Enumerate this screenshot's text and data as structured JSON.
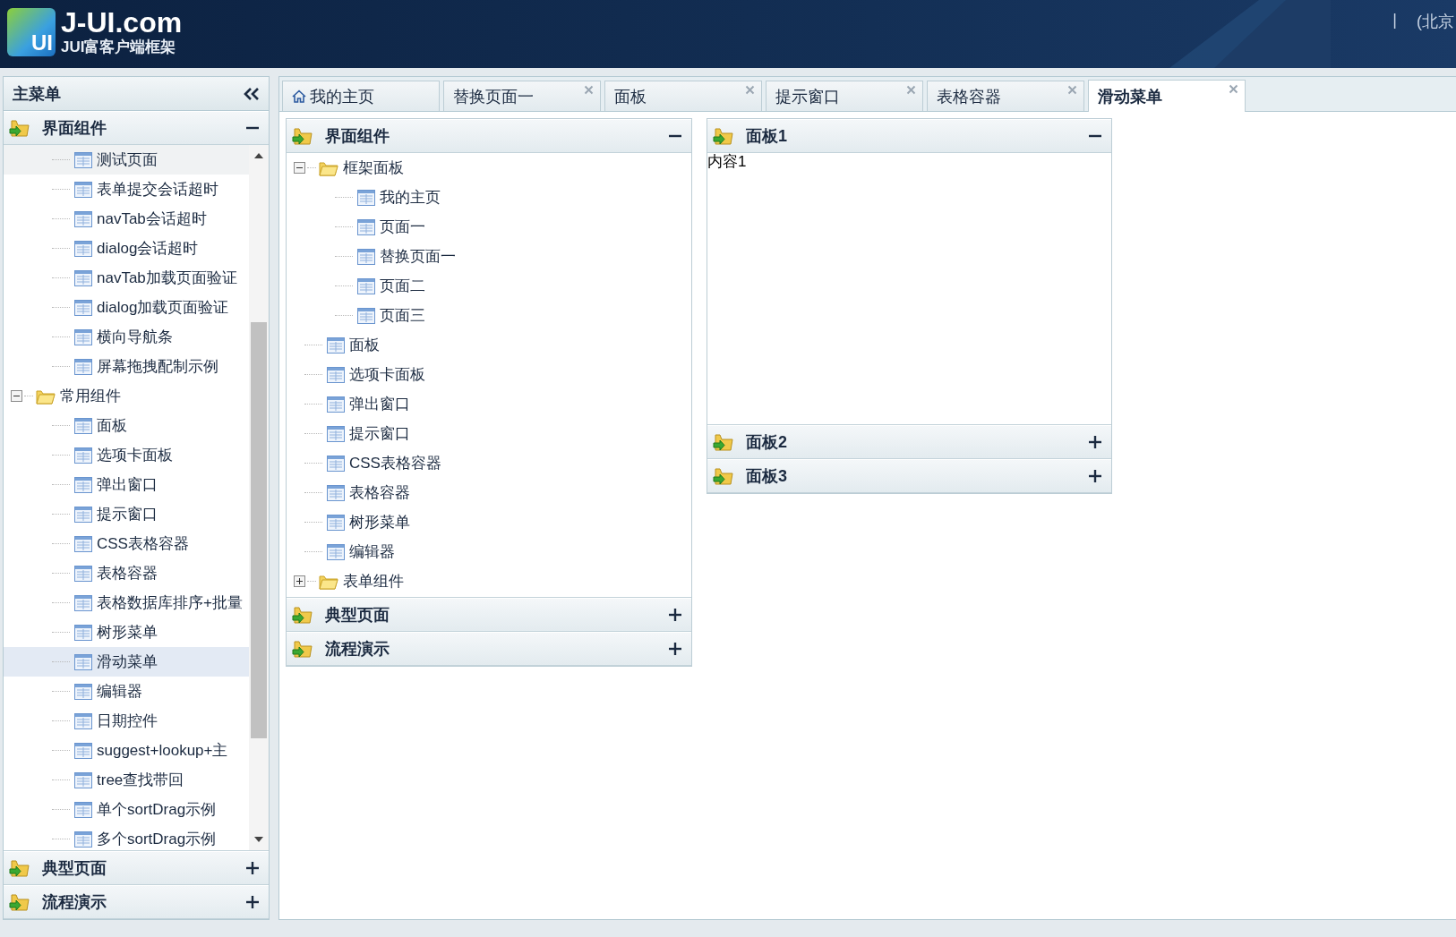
{
  "header": {
    "logo_mark": "UI",
    "logo_title": "J-UI.com",
    "logo_subtitle": "JUI富客户端框架",
    "top_right": [
      "|",
      "(北京"
    ]
  },
  "sidebar": {
    "title": "主菜单",
    "sections": [
      {
        "title": "界面组件",
        "expanded": true,
        "tree": [
          {
            "kind": "group",
            "children": [
              {
                "kind": "page",
                "label": "测试页面",
                "selected": false,
                "hovered": true
              },
              {
                "kind": "page",
                "label": "表单提交会话超时",
                "selected": false,
                "hovered": false
              },
              {
                "kind": "page",
                "label": "navTab会话超时",
                "selected": false,
                "hovered": false
              },
              {
                "kind": "page",
                "label": "dialog会话超时",
                "selected": false,
                "hovered": false
              },
              {
                "kind": "page",
                "label": "navTab加载页面验证",
                "selected": false,
                "hovered": false
              },
              {
                "kind": "page",
                "label": "dialog加载页面验证",
                "selected": false,
                "hovered": false
              },
              {
                "kind": "page",
                "label": "横向导航条",
                "selected": false,
                "hovered": false
              },
              {
                "kind": "page",
                "label": "屏幕拖拽配制示例",
                "selected": false,
                "hovered": false
              }
            ]
          },
          {
            "kind": "folder",
            "label": "常用组件",
            "expanded": true,
            "children": [
              {
                "kind": "page",
                "label": "面板",
                "selected": false,
                "hovered": false
              },
              {
                "kind": "page",
                "label": "选项卡面板",
                "selected": false,
                "hovered": false
              },
              {
                "kind": "page",
                "label": "弹出窗口",
                "selected": false,
                "hovered": false
              },
              {
                "kind": "page",
                "label": "提示窗口",
                "selected": false,
                "hovered": false
              },
              {
                "kind": "page",
                "label": "CSS表格容器",
                "selected": false,
                "hovered": false
              },
              {
                "kind": "page",
                "label": "表格容器",
                "selected": false,
                "hovered": false
              },
              {
                "kind": "page",
                "label": "表格数据库排序+批量",
                "selected": false,
                "hovered": false
              },
              {
                "kind": "page",
                "label": "树形菜单",
                "selected": false,
                "hovered": false
              },
              {
                "kind": "page",
                "label": "滑动菜单",
                "selected": true,
                "hovered": false
              },
              {
                "kind": "page",
                "label": "编辑器",
                "selected": false,
                "hovered": false
              },
              {
                "kind": "page",
                "label": "日期控件",
                "selected": false,
                "hovered": false
              },
              {
                "kind": "page",
                "label": "suggest+lookup+主",
                "selected": false,
                "hovered": false
              },
              {
                "kind": "page",
                "label": "tree查找带回",
                "selected": false,
                "hovered": false
              },
              {
                "kind": "page",
                "label": "单个sortDrag示例",
                "selected": false,
                "hovered": false
              },
              {
                "kind": "page",
                "label": "多个sortDrag示例",
                "selected": false,
                "hovered": false
              }
            ]
          }
        ]
      },
      {
        "title": "典型页面",
        "expanded": false
      },
      {
        "title": "流程演示",
        "expanded": false
      }
    ]
  },
  "tabs": [
    {
      "label": "我的主页",
      "kind": "home",
      "selected": false
    },
    {
      "label": "替换页面一",
      "kind": "closable",
      "selected": false
    },
    {
      "label": "面板",
      "kind": "closable",
      "selected": false
    },
    {
      "label": "提示窗口",
      "kind": "closable",
      "selected": false
    },
    {
      "label": "表格容器",
      "kind": "closable",
      "selected": false
    },
    {
      "label": "滑动菜单",
      "kind": "closable",
      "selected": true
    }
  ],
  "accordions": [
    {
      "kind": "tree",
      "panels": [
        {
          "title": "界面组件",
          "expanded": true,
          "tree": [
            {
              "kind": "folder",
              "label": "框架面板",
              "expanded": true,
              "children": [
                {
                  "kind": "page",
                  "label": "我的主页"
                },
                {
                  "kind": "page",
                  "label": "页面一"
                },
                {
                  "kind": "page",
                  "label": "替换页面一"
                },
                {
                  "kind": "page",
                  "label": "页面二"
                },
                {
                  "kind": "page",
                  "label": "页面三"
                }
              ]
            },
            {
              "kind": "page",
              "label": "面板"
            },
            {
              "kind": "page",
              "label": "选项卡面板"
            },
            {
              "kind": "page",
              "label": "弹出窗口"
            },
            {
              "kind": "page",
              "label": "提示窗口"
            },
            {
              "kind": "page",
              "label": "CSS表格容器"
            },
            {
              "kind": "page",
              "label": "表格容器"
            },
            {
              "kind": "page",
              "label": "树形菜单"
            },
            {
              "kind": "page",
              "label": "编辑器"
            },
            {
              "kind": "folder",
              "label": "表单组件",
              "expanded": false
            }
          ]
        },
        {
          "title": "典型页面",
          "expanded": false
        },
        {
          "title": "流程演示",
          "expanded": false
        }
      ]
    },
    {
      "kind": "text",
      "panels": [
        {
          "title": "面板1",
          "expanded": true,
          "content": "内容1"
        },
        {
          "title": "面板2",
          "expanded": false
        },
        {
          "title": "面板3",
          "expanded": false
        }
      ]
    }
  ]
}
